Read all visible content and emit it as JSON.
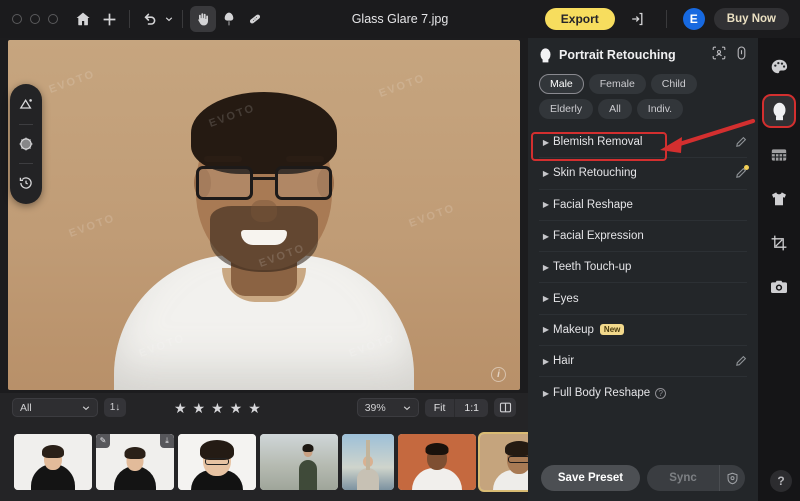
{
  "window": {
    "title": "Glass Glare 7.jpg",
    "traffic_lights": [
      "close",
      "minimize",
      "zoom"
    ]
  },
  "toolbar": {
    "home_label": "home-icon",
    "add_label": "plus-icon",
    "undo_label": "undo-icon",
    "tools": [
      {
        "name": "hand-tool",
        "glyph": "hand",
        "active": true
      },
      {
        "name": "brush-tool",
        "glyph": "brush",
        "active": false
      },
      {
        "name": "healing-tool",
        "glyph": "bandaid",
        "active": false
      }
    ],
    "export_label": "Export",
    "export_color": "#f7dd5e",
    "share_label": "share-icon",
    "avatar_initial": "E",
    "avatar_color": "#1769e0",
    "buy_label": "Buy Now"
  },
  "left_rail": {
    "items": [
      {
        "name": "crop-ratio-icon",
        "label": "Crop"
      },
      {
        "name": "texture-icon",
        "label": "Texture"
      },
      {
        "name": "history-icon",
        "label": "History"
      }
    ]
  },
  "canvas": {
    "watermark_text": "EVOTO",
    "info_label": "i",
    "background_color": "#c09c76"
  },
  "filmstrip_toolbar": {
    "filter_value": "All",
    "sort_label": "1↓",
    "stars": {
      "count": 5,
      "filled": 5,
      "glyph": "★"
    },
    "zoom_value": "39%",
    "fit_label": "Fit",
    "ratio_label": "1:1",
    "compare_label": "compare-icon"
  },
  "filmstrip": {
    "thumbnails": [
      {
        "name": "thumb-1",
        "bg": "#f0efed",
        "hair": "#2a2018",
        "skin": "#e2bb9a",
        "body": "#141414",
        "selected": false,
        "badges": []
      },
      {
        "name": "thumb-2",
        "bg": "#f0efed",
        "hair": "#2a2018",
        "skin": "#e2bb9a",
        "body": "#141414",
        "selected": false,
        "badges": [
          "edit",
          "download"
        ]
      },
      {
        "name": "thumb-3",
        "bg": "#f4f3f1",
        "hair": "#241b14",
        "skin": "#e7c3a3",
        "body": "#121212",
        "selected": false,
        "badges": []
      },
      {
        "name": "thumb-4",
        "bg": "#b9bcb8",
        "hair": "#1d1812",
        "skin": "#c9a183",
        "body": "#3f4a39",
        "selected": false,
        "badges": []
      },
      {
        "name": "thumb-5",
        "bg": "#7fa6c4",
        "hair": "#3a2a1e",
        "skin": "#d9b191",
        "body": "#c7c1b4",
        "selected": false,
        "badges": []
      },
      {
        "name": "thumb-6",
        "bg": "#c5693f",
        "hair": "#1a120c",
        "skin": "#7e4f32",
        "body": "#f1efec",
        "selected": false,
        "badges": []
      },
      {
        "name": "thumb-7",
        "bg": "#c5a47d",
        "hair": "#241a12",
        "skin": "#a87a54",
        "body": "#eeedea",
        "selected": true,
        "badges": []
      }
    ]
  },
  "right_panel": {
    "title": "Portrait Retouching",
    "header_icons": [
      {
        "name": "face-detect-icon"
      },
      {
        "name": "person-toggle-icon"
      }
    ],
    "chips": [
      {
        "label": "Male",
        "selected": true
      },
      {
        "label": "Female",
        "selected": false
      },
      {
        "label": "Child",
        "selected": false
      },
      {
        "label": "Elderly",
        "selected": false
      },
      {
        "label": "All",
        "selected": false
      },
      {
        "label": "Indiv.",
        "selected": false
      }
    ],
    "sections": [
      {
        "label": "Blemish Removal",
        "has_brush": true,
        "brush_dot": false,
        "tag": "",
        "has_help": false,
        "highlighted": true
      },
      {
        "label": "Skin Retouching",
        "has_brush": true,
        "brush_dot": true,
        "tag": "",
        "has_help": false,
        "highlighted": false
      },
      {
        "label": "Facial Reshape",
        "has_brush": false,
        "brush_dot": false,
        "tag": "",
        "has_help": false,
        "highlighted": false
      },
      {
        "label": "Facial Expression",
        "has_brush": false,
        "brush_dot": false,
        "tag": "",
        "has_help": false,
        "highlighted": false
      },
      {
        "label": "Teeth Touch-up",
        "has_brush": false,
        "brush_dot": false,
        "tag": "",
        "has_help": false,
        "highlighted": false
      },
      {
        "label": "Eyes",
        "has_brush": false,
        "brush_dot": false,
        "tag": "",
        "has_help": false,
        "highlighted": false
      },
      {
        "label": "Makeup",
        "has_brush": false,
        "brush_dot": false,
        "tag": "New",
        "has_help": false,
        "highlighted": false
      },
      {
        "label": "Hair",
        "has_brush": true,
        "brush_dot": false,
        "tag": "",
        "has_help": false,
        "highlighted": false
      },
      {
        "label": "Full Body Reshape",
        "has_brush": false,
        "brush_dot": false,
        "tag": "",
        "has_help": true,
        "highlighted": false
      }
    ],
    "footer": {
      "save_preset_label": "Save Preset",
      "sync_label": "Sync",
      "sync_settings_label": "sync-settings-icon"
    },
    "annotation": {
      "highlight_color": "#d32f2f",
      "arrow_target": "Blemish Removal"
    }
  },
  "far_rail": {
    "items": [
      {
        "name": "palette-icon",
        "active": false
      },
      {
        "name": "portrait-icon",
        "active": true
      },
      {
        "name": "grid-icon",
        "active": false
      },
      {
        "name": "clothing-icon",
        "active": false
      },
      {
        "name": "crop-icon",
        "active": false
      },
      {
        "name": "camera-icon",
        "active": false
      }
    ],
    "help_label": "?"
  }
}
